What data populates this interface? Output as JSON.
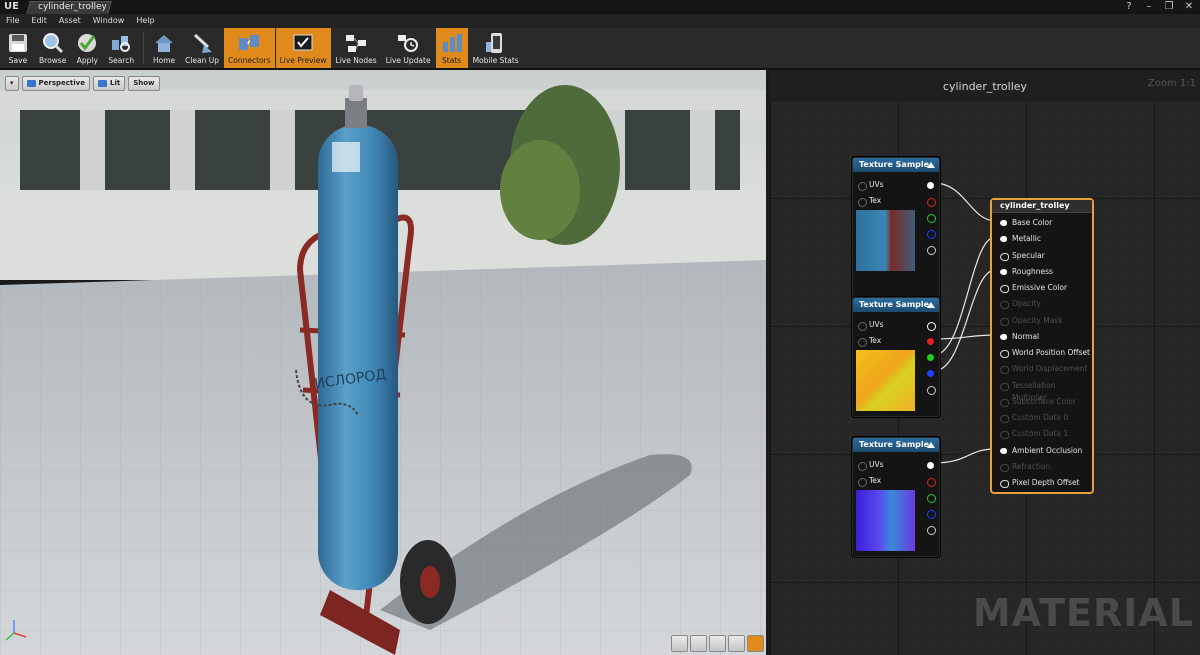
{
  "window": {
    "tab_title": "cylinder_trolley",
    "logo": "UE"
  },
  "menu": [
    "File",
    "Edit",
    "Asset",
    "Window",
    "Help"
  ],
  "toolbar": [
    {
      "label": "Save",
      "icon": "save-icon",
      "active": false
    },
    {
      "label": "Browse",
      "icon": "browse-icon",
      "active": false
    },
    {
      "label": "Apply",
      "icon": "apply-icon",
      "active": false
    },
    {
      "label": "Search",
      "icon": "search-icon",
      "active": false
    },
    {
      "label": "Home",
      "icon": "home-icon",
      "active": false
    },
    {
      "label": "Clean Up",
      "icon": "clean-up-icon",
      "active": false
    },
    {
      "label": "Connectors",
      "icon": "connectors-icon",
      "active": true
    },
    {
      "label": "Live Preview",
      "icon": "live-preview-icon",
      "active": true
    },
    {
      "label": "Live Nodes",
      "icon": "live-nodes-icon",
      "active": false
    },
    {
      "label": "Live Update",
      "icon": "live-update-icon",
      "active": false
    },
    {
      "label": "Stats",
      "icon": "stats-icon",
      "active": true
    },
    {
      "label": "Mobile Stats",
      "icon": "mobile-stats-icon",
      "active": false
    }
  ],
  "viewport": {
    "perspective_label": "Perspective",
    "lit_label": "Lit",
    "show_label": "Show"
  },
  "graph": {
    "title": "cylinder_trolley",
    "zoom": "Zoom 1:1",
    "watermark": "MATERIAL",
    "texture_nodes": [
      {
        "title": "Texture Sample",
        "uvs_label": "UVs",
        "tex_label": "Tex"
      },
      {
        "title": "Texture Sample",
        "uvs_label": "UVs",
        "tex_label": "Tex"
      },
      {
        "title": "Texture Sample",
        "uvs_label": "UVs",
        "tex_label": "Tex"
      }
    ],
    "material_node": {
      "title": "cylinder_trolley",
      "pins": [
        {
          "label": "Base Color",
          "enabled": true
        },
        {
          "label": "Metallic",
          "enabled": true
        },
        {
          "label": "Specular",
          "enabled": true
        },
        {
          "label": "Roughness",
          "enabled": true
        },
        {
          "label": "Emissive Color",
          "enabled": true
        },
        {
          "label": "Opacity",
          "enabled": false
        },
        {
          "label": "Opacity Mask",
          "enabled": false
        },
        {
          "label": "Normal",
          "enabled": true
        },
        {
          "label": "World Position Offset",
          "enabled": true
        },
        {
          "label": "World Displacement",
          "enabled": false
        },
        {
          "label": "Tessellation Multiplier",
          "enabled": false
        },
        {
          "label": "Subsurface Color",
          "enabled": false
        },
        {
          "label": "Custom Data 0",
          "enabled": false
        },
        {
          "label": "Custom Data 1",
          "enabled": false
        },
        {
          "label": "Ambient Occlusion",
          "enabled": true
        },
        {
          "label": "Refraction",
          "enabled": false
        },
        {
          "label": "Pixel Depth Offset",
          "enabled": true
        }
      ]
    }
  },
  "colors": {
    "accent": "#e08a1c",
    "node_header": "#2b6ca0",
    "material_border": "#e8a23c"
  }
}
